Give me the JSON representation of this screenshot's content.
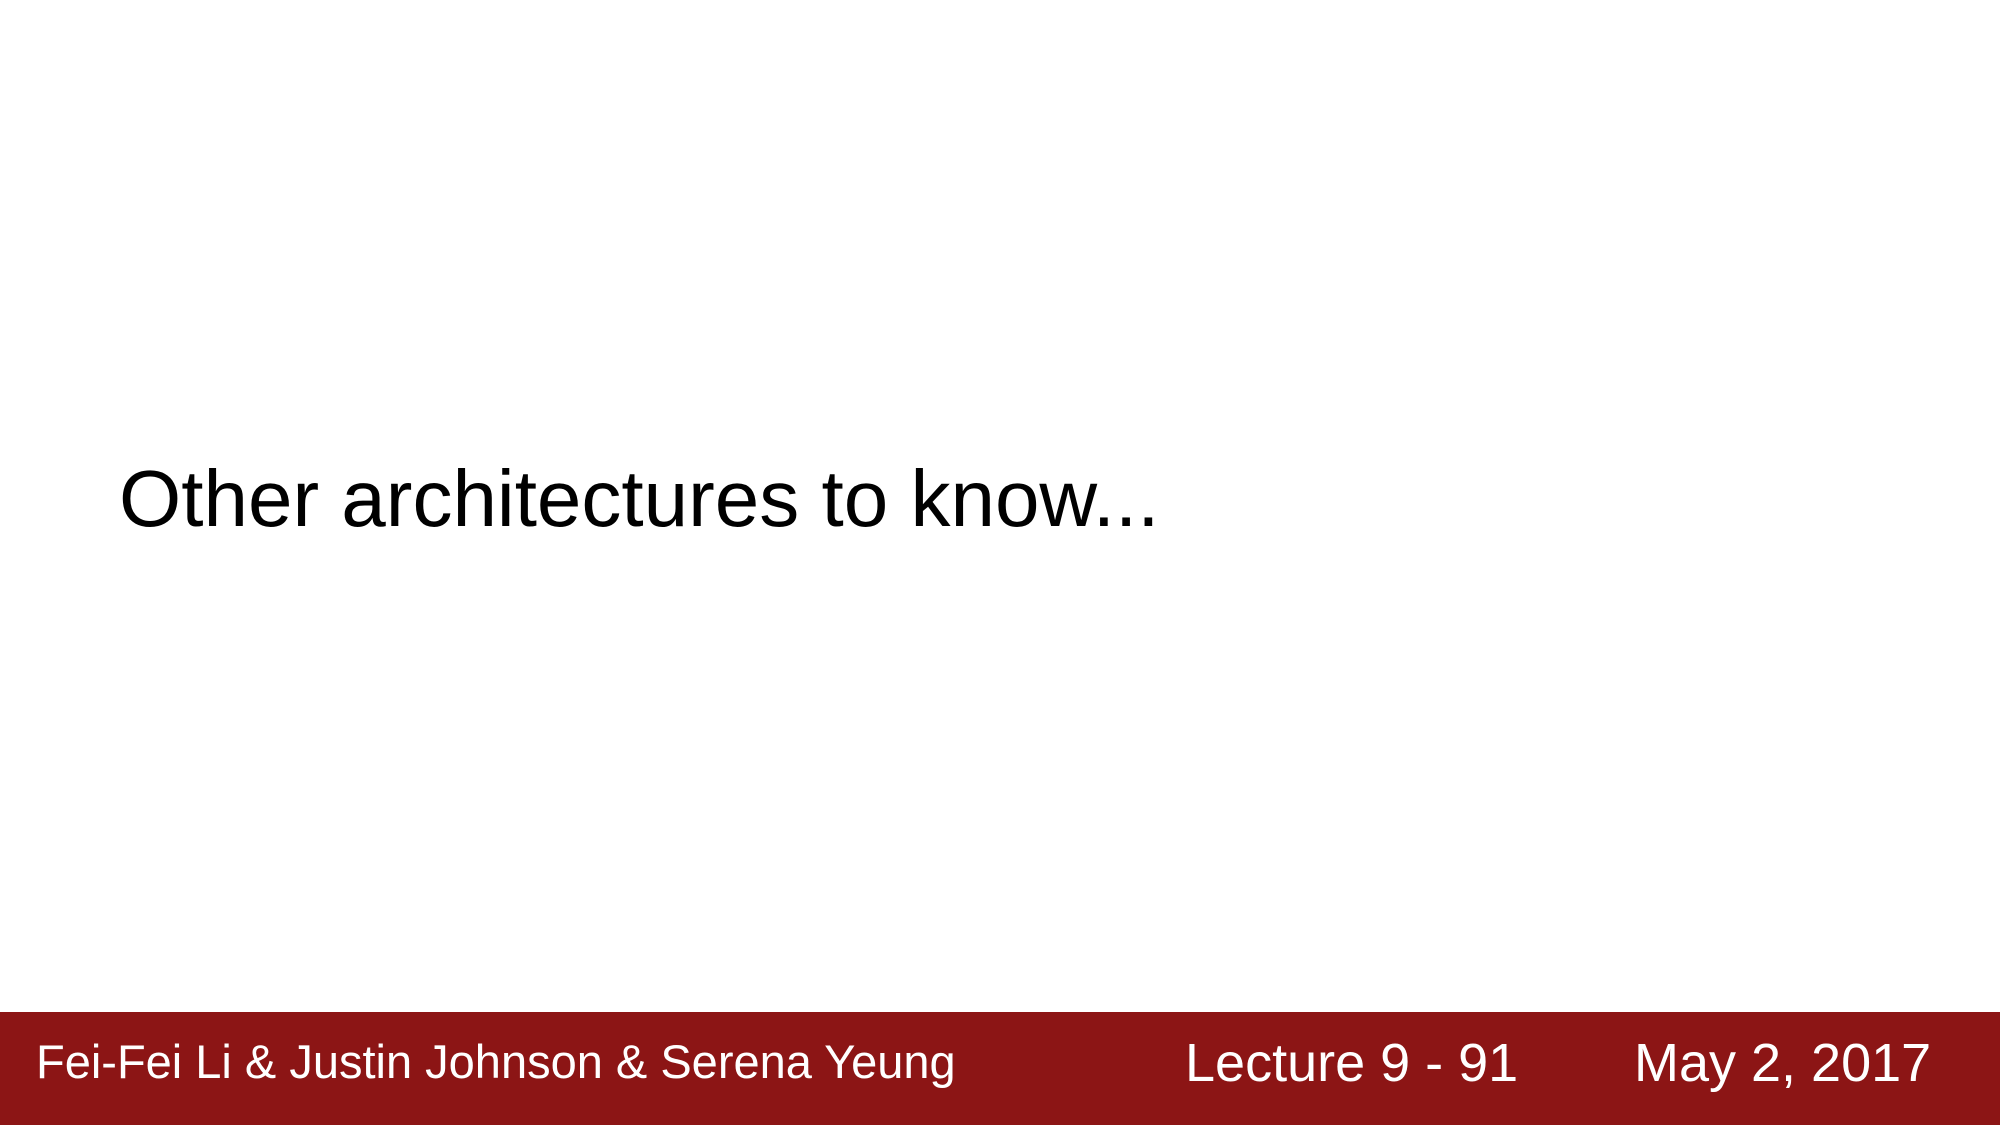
{
  "slide": {
    "title": "Other architectures to know..."
  },
  "footer": {
    "authors": "Fei-Fei Li & Justin Johnson & Serena Yeung",
    "lecture": "Lecture 9 - 91",
    "date": "May 2, 2017",
    "background_color": "#8c1515",
    "text_color": "#ffffff"
  }
}
